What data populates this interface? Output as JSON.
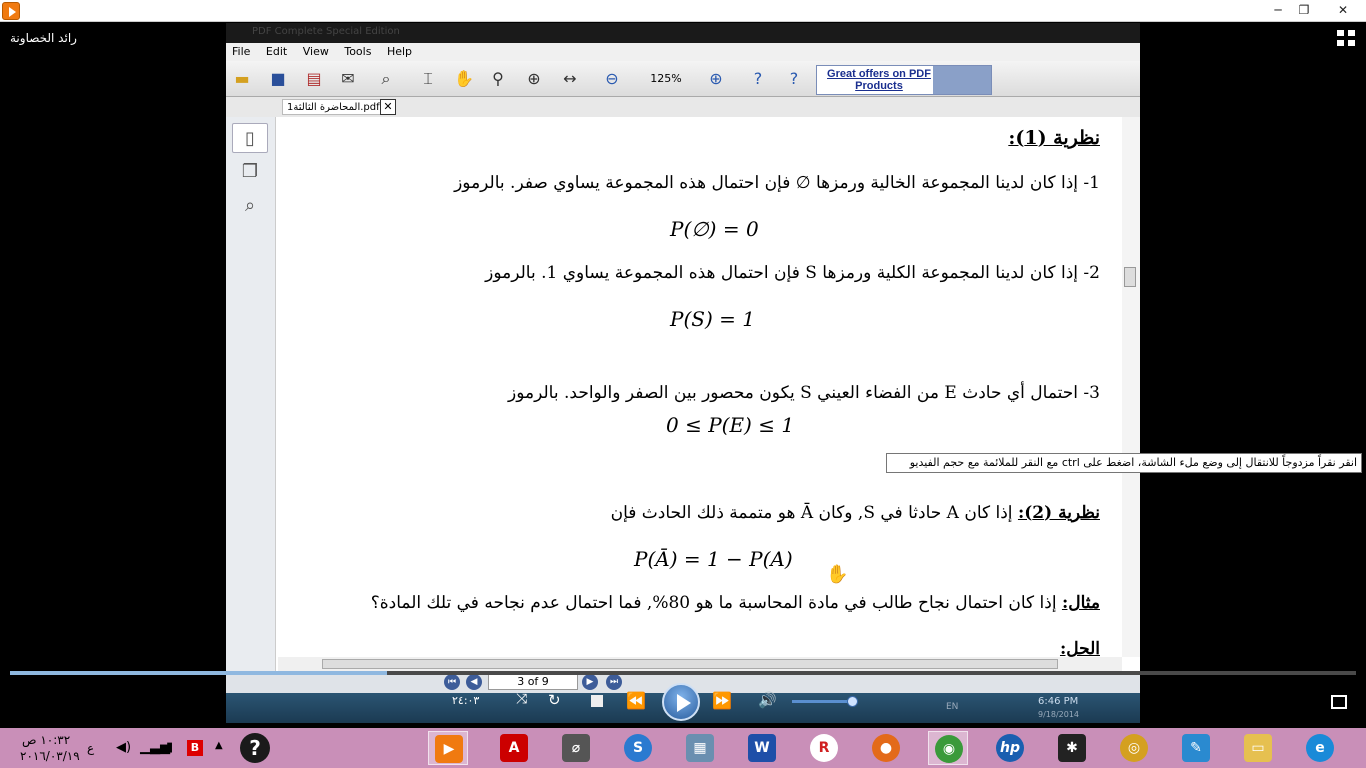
{
  "player": {
    "user_name": "رائد الخصاونة",
    "title_bar": {
      "minimize": "─",
      "restore": "❐",
      "close": "✕"
    },
    "tooltip": "انقر نقراً مزدوجاً للانتقال إلى وضع ملء الشاشة، اضغط على ctrl مع النقر للملائمة مع حجم الفيديو",
    "elapsed_time": "٢٤:٠٣",
    "seek_progress": 0.28,
    "volume_level": 0.95
  },
  "pdf_app": {
    "window_title": "PDF Complete Special Edition",
    "menu": [
      "File",
      "Edit",
      "View",
      "Tools",
      "Help"
    ],
    "zoom": "125%",
    "ad_text": "Great offers on PDF Products",
    "tab_name": "المحاضرة الثالثة1.pdf",
    "page_indicator": "3 of 9",
    "taskbar": {
      "time": "6:46 PM",
      "date": "9/18/2014",
      "lang": "EN"
    }
  },
  "document": {
    "theorem1_heading": "نظرية (1):",
    "item1": "1-  إذا كان لدينا المجموعة الخالية ورمزها  ∅  فإن احتمال هذه المجموعة يساوي صفر. بالرموز",
    "eq1": "P(∅) = 0",
    "item2": "2-  إذا كان لدينا المجموعة الكلية ورمزها S فإن احتمال هذه المجموعة يساوي 1. بالرموز",
    "eq2": "P(S) = 1",
    "item3": "3-  احتمال أي حادث E من الفضاء العيني  S  يكون محصور بين الصفر والواحد. بالرموز",
    "eq3": "0 ≤ P(E) ≤ 1",
    "theorem2_heading": "نظرية (2):",
    "theorem2_text": " إذا كان A حادثا في S, وكان Ā هو متممة ذلك الحادث فإن",
    "eq4": "P(Ā) = 1 − P(A)",
    "example_heading": "مثال:",
    "example_text": " إذا كان احتمال نجاح طالب في مادة المحاسبة ما هو 80%, فما احتمال عدم نجاحه في تلك المادة؟",
    "solution_heading": "الحل:"
  },
  "system_taskbar": {
    "time": "١٠:٣٢ ص",
    "date": "٢٠١٦/٠٣/١٩",
    "lang_indicator": "ع"
  }
}
